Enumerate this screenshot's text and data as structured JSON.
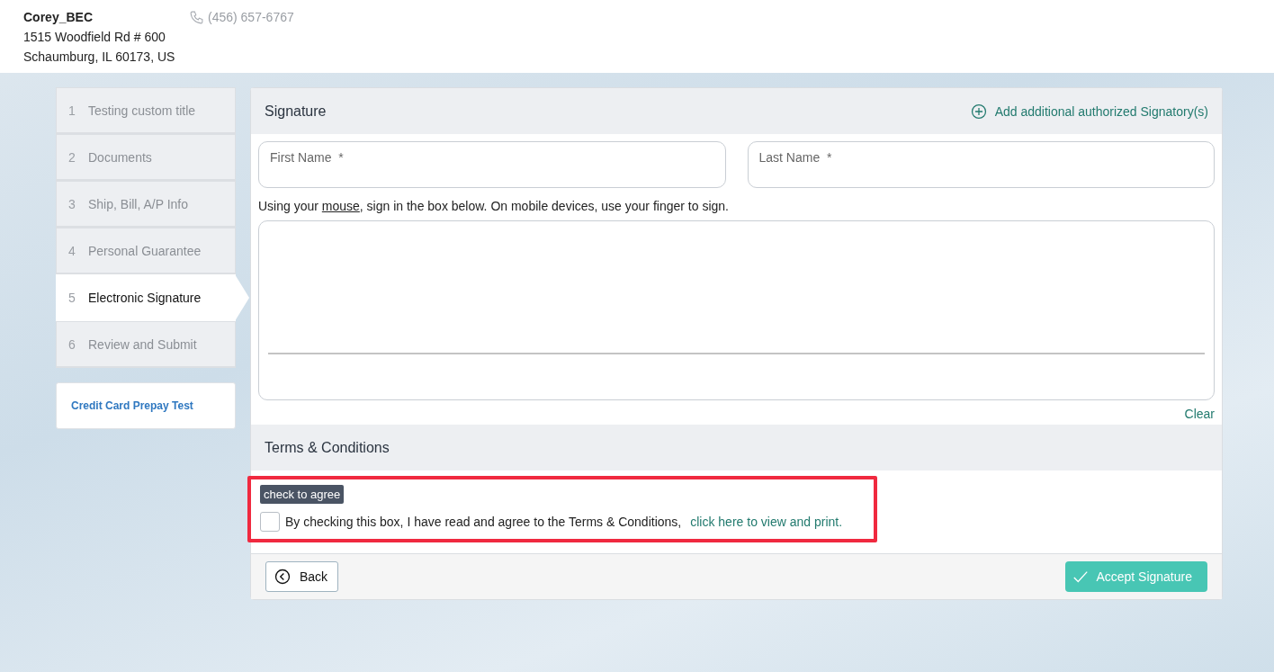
{
  "header": {
    "company": "Corey_BEC",
    "address_line_1": "1515 Woodfield Rd # 600",
    "address_line_2": "Schaumburg, IL 60173, US",
    "phone": "(456) 657-6767"
  },
  "steps": [
    {
      "number": "1",
      "label": "Testing custom title",
      "selected": false
    },
    {
      "number": "2",
      "label": "Documents",
      "selected": false
    },
    {
      "number": "3",
      "label": "Ship, Bill, A/P Info",
      "selected": false
    },
    {
      "number": "4",
      "label": "Personal Guarantee",
      "selected": false
    },
    {
      "number": "5",
      "label": "Electronic Signature",
      "selected": true
    },
    {
      "number": "6",
      "label": "Review and Submit",
      "selected": false
    }
  ],
  "form_name": "Credit Card Prepay Test",
  "signature": {
    "title": "Signature",
    "add_link": "Add additional authorized Signatory(s)",
    "fields": [
      {
        "placeholder": "First Name  *"
      },
      {
        "placeholder": "Last Name  *"
      }
    ],
    "instruction": {
      "before": "Using your ",
      "underlined": "mouse",
      "after": ", sign in the box below. On mobile devices, use your finger to sign."
    },
    "clear": "Clear"
  },
  "terms": {
    "title": "Terms & Conditions",
    "highlighted": true,
    "tooltip": "check to agree",
    "checked": false,
    "text": "By checking this box, I have read and agree to the Terms & Conditions,",
    "link": "click here to view and print."
  },
  "buttons": {
    "back": "Back",
    "accept": "Accept Signature"
  }
}
